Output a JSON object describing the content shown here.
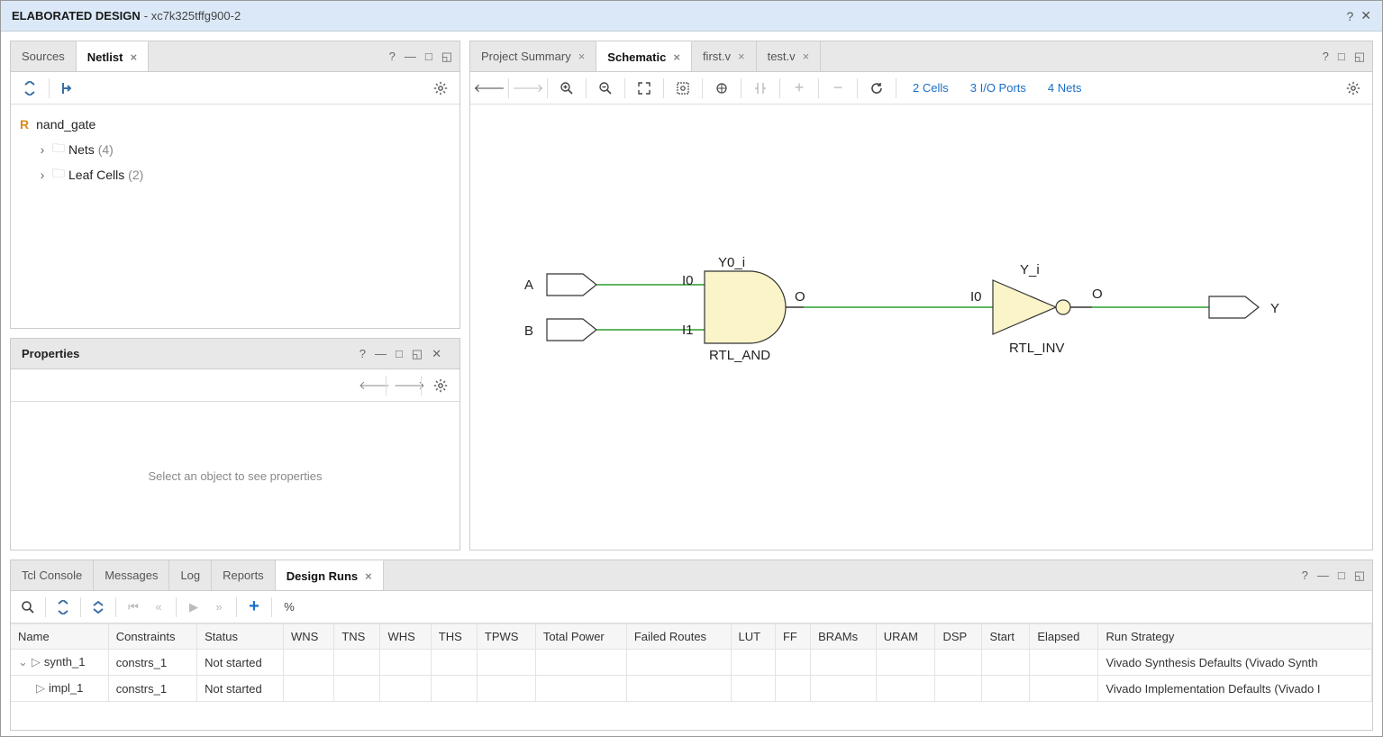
{
  "header": {
    "title": "ELABORATED DESIGN",
    "subtitle": "- xc7k325tffg900-2"
  },
  "netlist": {
    "tabs": {
      "sources": "Sources",
      "netlist": "Netlist"
    },
    "root": "nand_gate",
    "items": [
      {
        "label": "Nets",
        "count": "(4)"
      },
      {
        "label": "Leaf Cells",
        "count": "(2)"
      }
    ]
  },
  "properties": {
    "title": "Properties",
    "placeholder": "Select an object to see properties"
  },
  "schematic": {
    "tabs": {
      "projsum": "Project Summary",
      "schematic": "Schematic",
      "firstv": "first.v",
      "testv": "test.v"
    },
    "links": {
      "cells": "2 Cells",
      "ioports": "3 I/O Ports",
      "nets": "4 Nets"
    },
    "labels": {
      "a": "A",
      "b": "B",
      "y": "Y",
      "i0": "I0",
      "i1": "I1",
      "o": "O",
      "y0i": "Y0_i",
      "yi": "Y_i",
      "rtland": "RTL_AND",
      "rtlinv": "RTL_INV"
    }
  },
  "bottom": {
    "tabs": {
      "tcl": "Tcl Console",
      "messages": "Messages",
      "log": "Log",
      "reports": "Reports",
      "runs": "Design Runs"
    },
    "columns": [
      "Name",
      "Constraints",
      "Status",
      "WNS",
      "TNS",
      "WHS",
      "THS",
      "TPWS",
      "Total Power",
      "Failed Routes",
      "LUT",
      "FF",
      "BRAMs",
      "URAM",
      "DSP",
      "Start",
      "Elapsed",
      "Run Strategy"
    ],
    "rows": [
      {
        "name": "synth_1",
        "indent": 0,
        "expand": "v",
        "constraints": "constrs_1",
        "status": "Not started",
        "strategy": "Vivado Synthesis Defaults (Vivado Synth"
      },
      {
        "name": "impl_1",
        "indent": 1,
        "expand": "",
        "constraints": "constrs_1",
        "status": "Not started",
        "strategy": "Vivado Implementation Defaults (Vivado I"
      }
    ]
  },
  "toolbar_icons": {
    "percent": "%"
  }
}
